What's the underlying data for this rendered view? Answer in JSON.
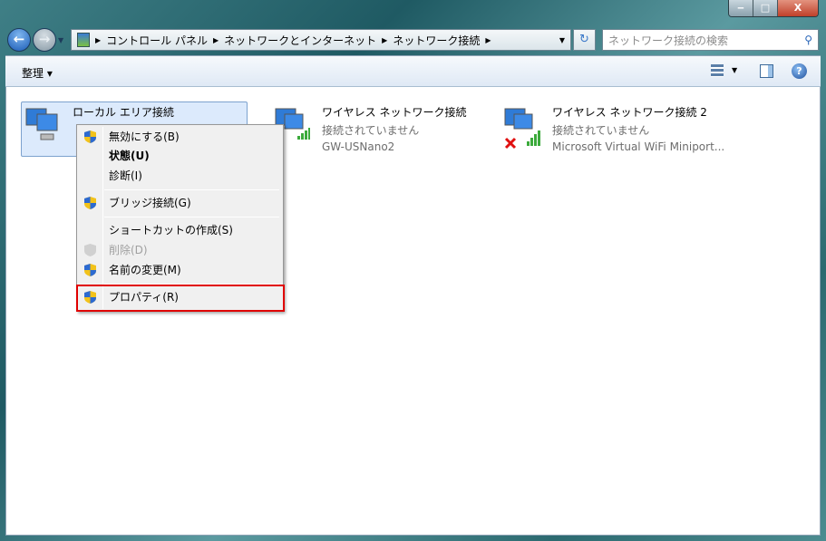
{
  "window": {
    "minimize": "‒",
    "maximize": "□",
    "close": "X"
  },
  "nav": {
    "back": "←",
    "forward": "→",
    "breadcrumb": [
      "コントロール パネル",
      "ネットワークとインターネット",
      "ネットワーク接続"
    ],
    "search_placeholder": "ネットワーク接続の検索"
  },
  "toolbar": {
    "organize": "整理 ▾"
  },
  "connections": [
    {
      "name": "ローカル エリア接続",
      "status": "",
      "device": ""
    },
    {
      "name": "ワイヤレス ネットワーク接続",
      "status": "接続されていません",
      "device": "GW-USNano2"
    },
    {
      "name": "ワイヤレス ネットワーク接続 2",
      "status": "接続されていません",
      "device": "Microsoft Virtual WiFi Miniport..."
    }
  ],
  "context_menu": [
    {
      "label": "無効にする(B)",
      "shield": true
    },
    {
      "label": "状態(U)",
      "bold": true
    },
    {
      "label": "診断(I)"
    },
    {
      "label": "ブリッジ接続(G)",
      "shield": true
    },
    {
      "label": "ショートカットの作成(S)"
    },
    {
      "label": "削除(D)",
      "disabled": true,
      "shield": true
    },
    {
      "label": "名前の変更(M)",
      "shield": true
    },
    {
      "label": "プロパティ(R)",
      "shield": true,
      "highlighted": true
    }
  ],
  "colors": {
    "highlight": "#e00000",
    "selection": "#dceafc"
  }
}
